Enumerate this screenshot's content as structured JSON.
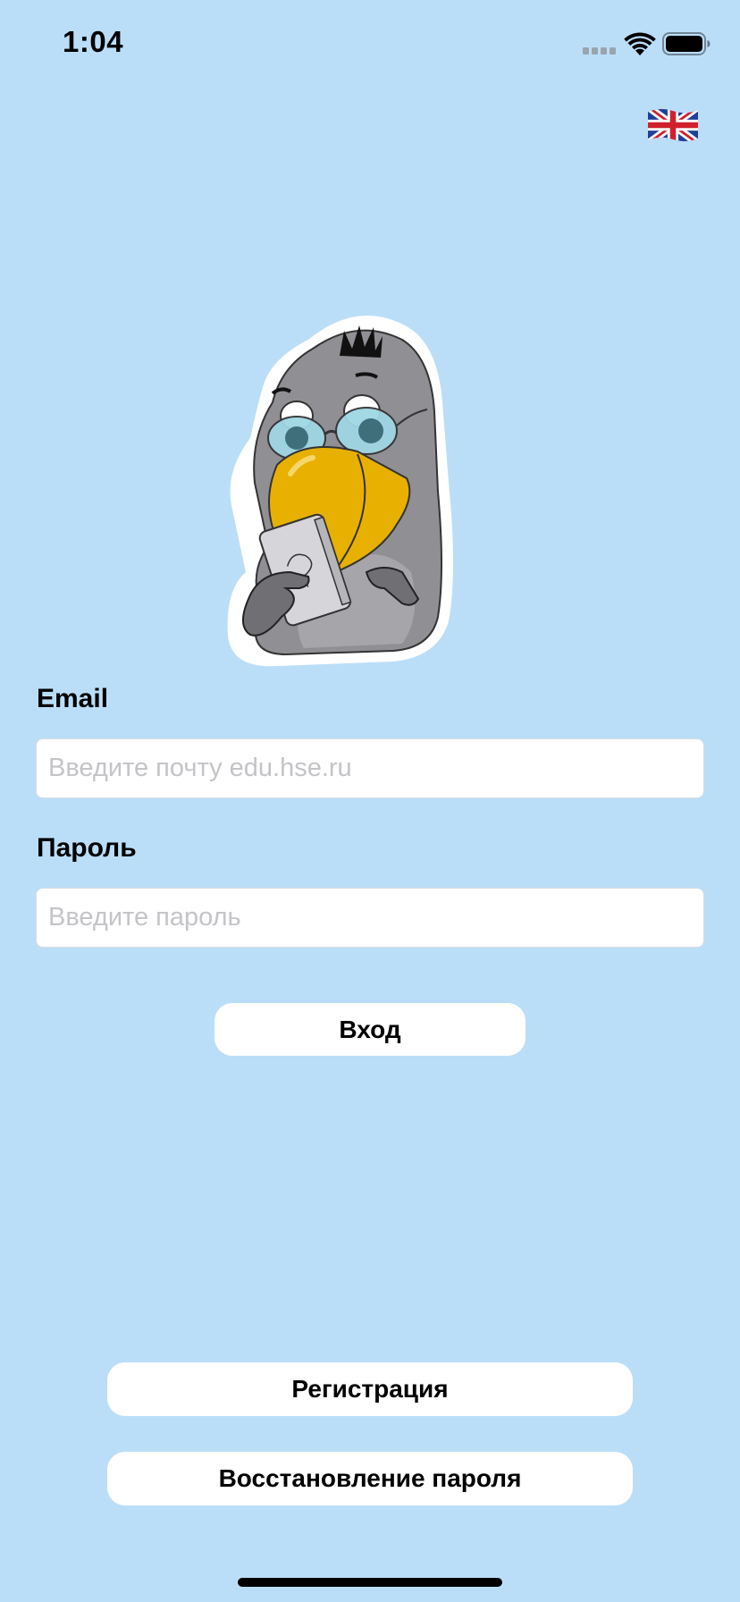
{
  "status_bar": {
    "time": "1:04"
  },
  "language_button": {
    "icon": "uk-flag-icon"
  },
  "mascot": {
    "icon": "penguin-reading-phone-icon"
  },
  "login_form": {
    "email_label": "Email",
    "email_placeholder": "Введите почту edu.hse.ru",
    "email_value": "",
    "password_label": "Пароль",
    "password_placeholder": "Введите пароль",
    "password_value": "",
    "login_button": "Вход"
  },
  "bottom_actions": {
    "register_button": "Регистрация",
    "recover_password_button": "Восстановление пароля"
  },
  "colors": {
    "background": "#bbdef8",
    "button_bg": "#ffffff",
    "beak": "#e8b000",
    "body_gray": "#8f8f94"
  }
}
